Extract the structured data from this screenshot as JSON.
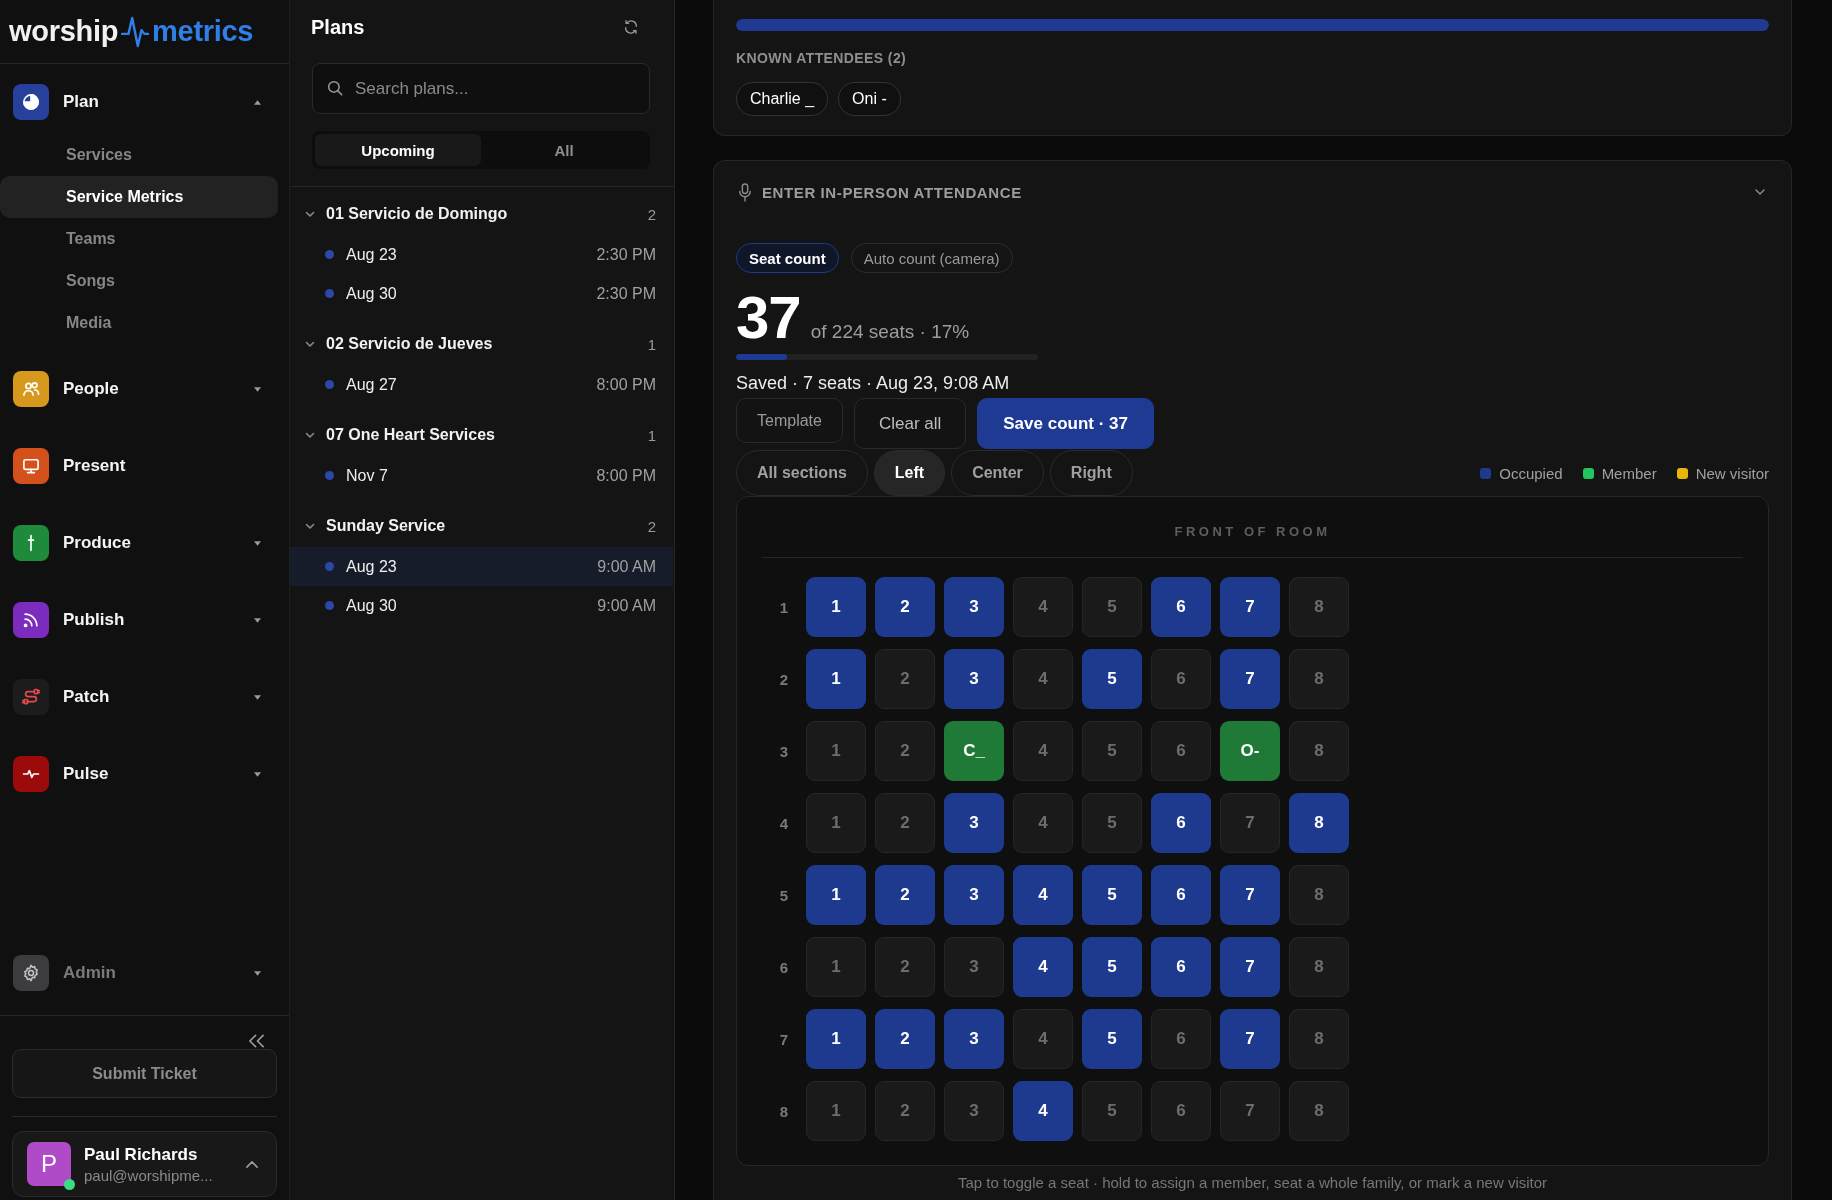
{
  "sidebar": {
    "logo": {
      "word_1": "worship",
      "word_2": "metrics"
    },
    "nav": [
      {
        "label": "Plan",
        "kind": "group",
        "color": "#26409c",
        "expanded": true,
        "children": [
          {
            "label": "Services",
            "selected": false
          },
          {
            "label": "Service Metrics",
            "selected": true
          },
          {
            "label": "Teams",
            "selected": false
          },
          {
            "label": "Songs",
            "selected": false
          },
          {
            "label": "Media",
            "selected": false
          }
        ]
      },
      {
        "label": "People",
        "kind": "group",
        "color": "#d6991e",
        "expanded": false
      },
      {
        "label": "Present",
        "kind": "link",
        "color": "#d4511c"
      },
      {
        "label": "Produce",
        "kind": "group",
        "color": "#1d8a3c",
        "expanded": false
      },
      {
        "label": "Publish",
        "kind": "group",
        "color": "#7b2cbf",
        "expanded": false
      },
      {
        "label": "Patch",
        "kind": "group",
        "color": "#1c1c1e",
        "expanded": false
      },
      {
        "label": "Pulse",
        "kind": "group",
        "color": "#9b0b0b",
        "expanded": false
      }
    ],
    "admin": {
      "label": "Admin",
      "color": "#3c3c40",
      "expanded": false,
      "disabled": true
    },
    "submit_button": "Submit Ticket",
    "user": {
      "initial": "P",
      "name": "Paul Richards",
      "email": "paul@worshipme...",
      "online": true
    }
  },
  "plans_panel": {
    "title": "Plans",
    "search": {
      "placeholder": "Search plans..."
    },
    "tabs": [
      {
        "label": "Upcoming",
        "selected": true
      },
      {
        "label": "All",
        "selected": false
      }
    ],
    "groups": [
      {
        "title": "01 Servicio de Domingo",
        "count": "2",
        "expanded": true,
        "plans": [
          {
            "date": "Aug 23",
            "time": "2:30 PM",
            "selected": false
          },
          {
            "date": "Aug 30",
            "time": "2:30 PM",
            "selected": false
          }
        ]
      },
      {
        "title": "02 Servicio de Jueves",
        "count": "1",
        "expanded": true,
        "plans": [
          {
            "date": "Aug 27",
            "time": "8:00 PM",
            "selected": false
          }
        ]
      },
      {
        "title": "07 One Heart Services",
        "count": "1",
        "expanded": true,
        "plans": [
          {
            "date": "Nov 7",
            "time": "8:00 PM",
            "selected": false
          }
        ]
      },
      {
        "title": "Sunday Service",
        "count": "2",
        "expanded": true,
        "plans": [
          {
            "date": "Aug 23",
            "time": "9:00 AM",
            "selected": true
          },
          {
            "date": "Aug 30",
            "time": "9:00 AM",
            "selected": false
          }
        ]
      }
    ]
  },
  "known_attendees_card": {
    "progress": {
      "level": 1.0
    },
    "heading": "KNOWN ATTENDEES (2)",
    "attendees": [
      "Charlie _",
      "Oni -"
    ]
  },
  "attendance_card": {
    "title": "ENTER IN-PERSON ATTENDANCE",
    "modes": [
      {
        "label": "Seat count",
        "selected": true
      },
      {
        "label": "Auto count (camera)",
        "selected": false
      }
    ],
    "count": "37",
    "count_detail": "of 224 seats · 17%",
    "progress": {
      "level": 0.17
    },
    "saved_status": "Saved · 7 seats · Aug 23, 9:08 AM",
    "actions": [
      {
        "label": "Template",
        "kind": "subtle"
      },
      {
        "label": "Clear all",
        "kind": "secondary"
      },
      {
        "label": "Save count · 37",
        "kind": "primary"
      }
    ],
    "sections": [
      {
        "label": "All sections",
        "selected": false
      },
      {
        "label": "Left",
        "selected": true
      },
      {
        "label": "Center",
        "selected": false
      },
      {
        "label": "Right",
        "selected": false
      }
    ],
    "legend": [
      {
        "label": "Occupied",
        "color": "#1e3a8a"
      },
      {
        "label": "Member",
        "color": "#22c55e"
      },
      {
        "label": "New visitor",
        "color": "#eab308"
      }
    ],
    "seat_map": {
      "heading": "FRONT OF ROOM",
      "rows": [
        {
          "label": "1",
          "seats": [
            {
              "label": "1",
              "kind": "occupied"
            },
            {
              "label": "2",
              "kind": "occupied"
            },
            {
              "label": "3",
              "kind": "occupied"
            },
            {
              "label": "4",
              "kind": "empty"
            },
            {
              "label": "5",
              "kind": "empty"
            },
            {
              "label": "6",
              "kind": "occupied"
            },
            {
              "label": "7",
              "kind": "occupied"
            },
            {
              "label": "8",
              "kind": "empty"
            }
          ]
        },
        {
          "label": "2",
          "seats": [
            {
              "label": "1",
              "kind": "occupied"
            },
            {
              "label": "2",
              "kind": "empty"
            },
            {
              "label": "3",
              "kind": "occupied"
            },
            {
              "label": "4",
              "kind": "empty"
            },
            {
              "label": "5",
              "kind": "occupied"
            },
            {
              "label": "6",
              "kind": "empty"
            },
            {
              "label": "7",
              "kind": "occupied"
            },
            {
              "label": "8",
              "kind": "empty"
            }
          ]
        },
        {
          "label": "3",
          "seats": [
            {
              "label": "1",
              "kind": "empty"
            },
            {
              "label": "2",
              "kind": "empty"
            },
            {
              "label": "C_",
              "kind": "member"
            },
            {
              "label": "4",
              "kind": "empty"
            },
            {
              "label": "5",
              "kind": "empty"
            },
            {
              "label": "6",
              "kind": "empty"
            },
            {
              "label": "O-",
              "kind": "member"
            },
            {
              "label": "8",
              "kind": "empty"
            }
          ]
        },
        {
          "label": "4",
          "seats": [
            {
              "label": "1",
              "kind": "empty"
            },
            {
              "label": "2",
              "kind": "empty"
            },
            {
              "label": "3",
              "kind": "occupied"
            },
            {
              "label": "4",
              "kind": "empty"
            },
            {
              "label": "5",
              "kind": "empty"
            },
            {
              "label": "6",
              "kind": "occupied"
            },
            {
              "label": "7",
              "kind": "empty"
            },
            {
              "label": "8",
              "kind": "occupied"
            }
          ]
        },
        {
          "label": "5",
          "seats": [
            {
              "label": "1",
              "kind": "occupied"
            },
            {
              "label": "2",
              "kind": "occupied"
            },
            {
              "label": "3",
              "kind": "occupied"
            },
            {
              "label": "4",
              "kind": "occupied"
            },
            {
              "label": "5",
              "kind": "occupied"
            },
            {
              "label": "6",
              "kind": "occupied"
            },
            {
              "label": "7",
              "kind": "occupied"
            },
            {
              "label": "8",
              "kind": "empty"
            }
          ]
        },
        {
          "label": "6",
          "seats": [
            {
              "label": "1",
              "kind": "empty"
            },
            {
              "label": "2",
              "kind": "empty"
            },
            {
              "label": "3",
              "kind": "empty"
            },
            {
              "label": "4",
              "kind": "occupied"
            },
            {
              "label": "5",
              "kind": "occupied"
            },
            {
              "label": "6",
              "kind": "occupied"
            },
            {
              "label": "7",
              "kind": "occupied"
            },
            {
              "label": "8",
              "kind": "empty"
            }
          ]
        },
        {
          "label": "7",
          "seats": [
            {
              "label": "1",
              "kind": "occupied"
            },
            {
              "label": "2",
              "kind": "occupied"
            },
            {
              "label": "3",
              "kind": "occupied"
            },
            {
              "label": "4",
              "kind": "empty"
            },
            {
              "label": "5",
              "kind": "occupied"
            },
            {
              "label": "6",
              "kind": "empty"
            },
            {
              "label": "7",
              "kind": "occupied"
            },
            {
              "label": "8",
              "kind": "empty"
            }
          ]
        },
        {
          "label": "8",
          "seats": [
            {
              "label": "1",
              "kind": "empty"
            },
            {
              "label": "2",
              "kind": "empty"
            },
            {
              "label": "3",
              "kind": "empty"
            },
            {
              "label": "4",
              "kind": "occupied"
            },
            {
              "label": "5",
              "kind": "empty"
            },
            {
              "label": "6",
              "kind": "empty"
            },
            {
              "label": "7",
              "kind": "empty"
            },
            {
              "label": "8",
              "kind": "empty"
            }
          ]
        }
      ]
    },
    "hint": "Tap to toggle a seat · hold to assign a member, seat a whole family, or mark a new visitor"
  }
}
